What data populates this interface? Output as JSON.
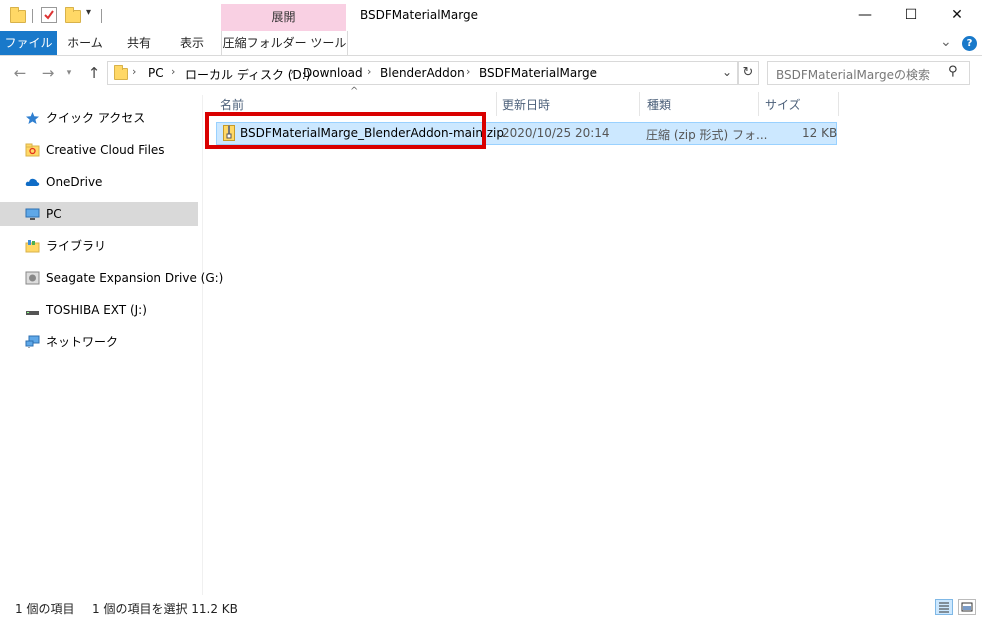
{
  "window": {
    "title": "BSDFMaterialMarge",
    "context_tab_header": "展開",
    "minimize": "—",
    "maximize": "☐",
    "close": "✕"
  },
  "ribbon": {
    "tabs": [
      "ファイル",
      "ホーム",
      "共有",
      "表示",
      "圧縮フォルダー ツール"
    ],
    "collapse": "⌄",
    "help": "?"
  },
  "address": {
    "breadcrumbs": [
      "PC",
      "ローカル ディスク (D:)",
      "Download",
      "BlenderAddon",
      "BSDFMaterialMarge"
    ],
    "search_placeholder": "BSDFMaterialMargeの検索"
  },
  "nav_pane": {
    "items": [
      {
        "label": "クイック アクセス",
        "icon": "star-icon"
      },
      {
        "label": "Creative Cloud Files",
        "icon": "creative-cloud-folder-icon"
      },
      {
        "label": "OneDrive",
        "icon": "cloud-icon"
      },
      {
        "label": "PC",
        "icon": "computer-icon"
      },
      {
        "label": "ライブラリ",
        "icon": "library-icon"
      },
      {
        "label": "Seagate Expansion Drive (G:)",
        "icon": "drive-icon"
      },
      {
        "label": "TOSHIBA EXT (J:)",
        "icon": "usb-drive-icon"
      },
      {
        "label": "ネットワーク",
        "icon": "network-icon"
      }
    ],
    "selected": "PC"
  },
  "file_list": {
    "columns": {
      "name": "名前",
      "date": "更新日時",
      "type": "種類",
      "size": "サイズ"
    },
    "rows": [
      {
        "name": "BSDFMaterialMarge_BlenderAddon-main.zip",
        "date": "2020/10/25 20:14",
        "type": "圧縮 (zip 形式) フォ...",
        "size": "12 KB"
      }
    ]
  },
  "status": {
    "count": "1 個の項目",
    "selection": "1 個の項目を選択  11.2 KB"
  },
  "colors": {
    "accent": "#1979ca",
    "context_tab": "#f9d0e3",
    "selection": "#cce8ff",
    "highlight": "#d90000"
  }
}
